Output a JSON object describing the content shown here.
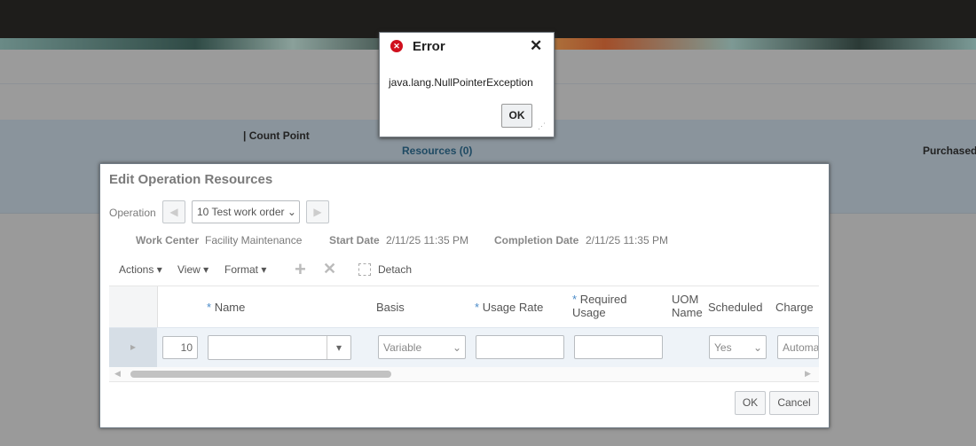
{
  "background": {
    "count_point": "Count Point",
    "resources_link": "Resources (0)",
    "purchased": "Purchased"
  },
  "dialog": {
    "title": "Edit Operation Resources",
    "operation_label": "Operation",
    "operation_value": "10 Test work order",
    "work_center_label": "Work Center",
    "work_center": "Facility Maintenance",
    "start_date_label": "Start Date",
    "start_date": "2/11/25 11:35 PM",
    "completion_date_label": "Completion Date",
    "completion_date": "2/11/25 11:35 PM",
    "toolbar": {
      "actions": "Actions",
      "view": "View",
      "format": "Format",
      "detach": "Detach"
    },
    "columns": [
      "Name",
      "Basis",
      "Usage Rate",
      "Required Usage",
      "UOM Name",
      "Scheduled",
      "Charge"
    ],
    "row": {
      "seq": "10",
      "name": "",
      "basis": "Variable",
      "usage_rate": "",
      "required_usage": "",
      "uom": "",
      "scheduled": "Yes",
      "charge": "Automat"
    },
    "ok": "OK",
    "cancel": "Cancel"
  },
  "error": {
    "title": "Error",
    "message": "java.lang.NullPointerException",
    "ok": "OK"
  }
}
